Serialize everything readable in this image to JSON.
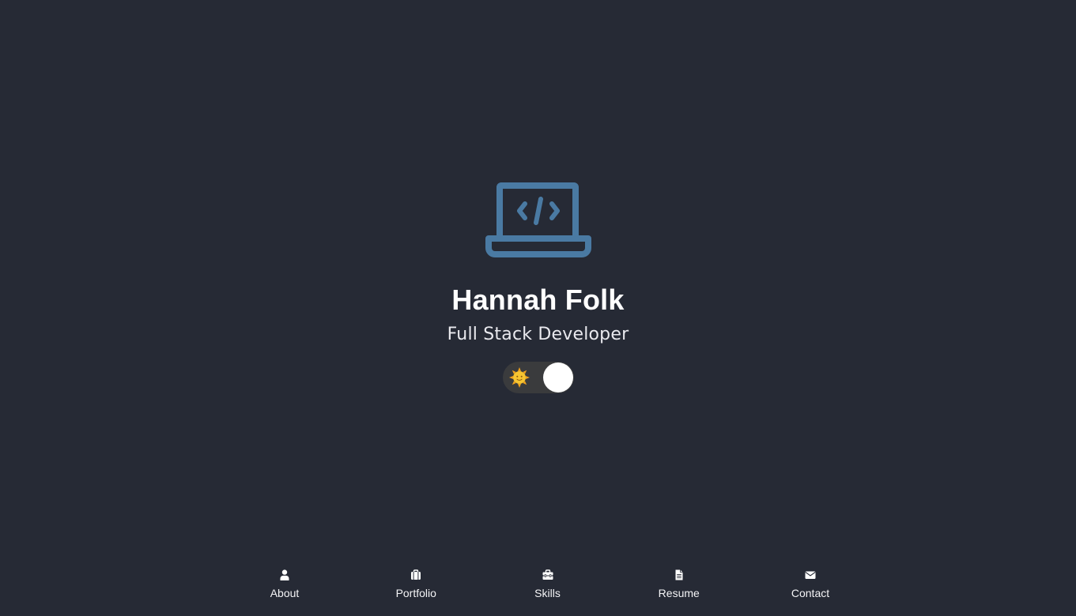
{
  "hero": {
    "icon": "laptop-code-icon",
    "name": "Hannah Folk",
    "role": "Full Stack Developer",
    "icon_color": "#4a7aa3"
  },
  "theme_toggle": {
    "icon": "sun-emoji-icon",
    "state": "dark"
  },
  "nav": {
    "items": [
      {
        "label": "About",
        "icon": "user-icon"
      },
      {
        "label": "Portfolio",
        "icon": "briefcase-icon"
      },
      {
        "label": "Skills",
        "icon": "toolbox-icon"
      },
      {
        "label": "Resume",
        "icon": "document-icon"
      },
      {
        "label": "Contact",
        "icon": "envelope-icon"
      }
    ]
  },
  "colors": {
    "background": "#262a35",
    "text": "#ffffff",
    "toggle_track": "#3a3b3d"
  }
}
